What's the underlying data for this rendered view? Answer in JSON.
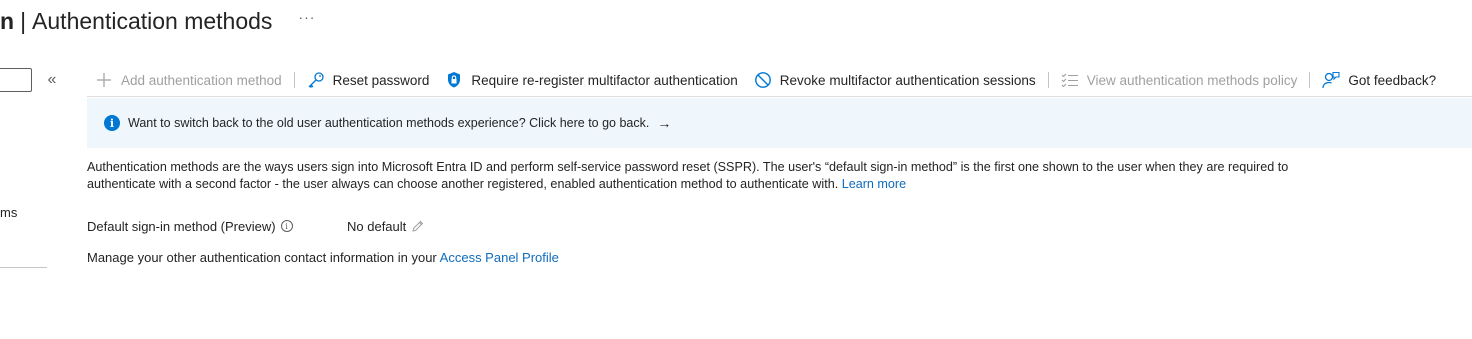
{
  "title": {
    "bold_fragment": "n",
    "separator": "|",
    "text": "Authentication methods",
    "more": "···"
  },
  "left_blade": {
    "collapse": "«",
    "fragment_text": "ms"
  },
  "toolbar": {
    "add_method": "Add authentication method",
    "reset_password": "Reset password",
    "require_reregister": "Require re-register multifactor authentication",
    "revoke_sessions": "Revoke multifactor authentication sessions",
    "view_policy": "View authentication methods policy",
    "feedback": "Got feedback?"
  },
  "banner": {
    "text": "Want to switch back to the old user authentication methods experience? Click here to go back.",
    "arrow": "→"
  },
  "description": {
    "text": "Authentication methods are the ways users sign into Microsoft Entra ID and perform self-service password reset (SSPR). The user's “default sign-in method” is the first one shown to the user when they are required to authenticate with a second factor - the user always can choose another registered, enabled authentication method to authenticate with.",
    "learn_more": "Learn more"
  },
  "default_signin": {
    "label": "Default sign-in method (Preview)",
    "value": "No default"
  },
  "manage": {
    "text": "Manage your other authentication contact information in your",
    "link": "Access Panel Profile"
  },
  "colors": {
    "accent": "#0078d4",
    "link": "#0f6cbd",
    "banner_bg": "#eff6fc",
    "disabled": "#a19f9d"
  }
}
